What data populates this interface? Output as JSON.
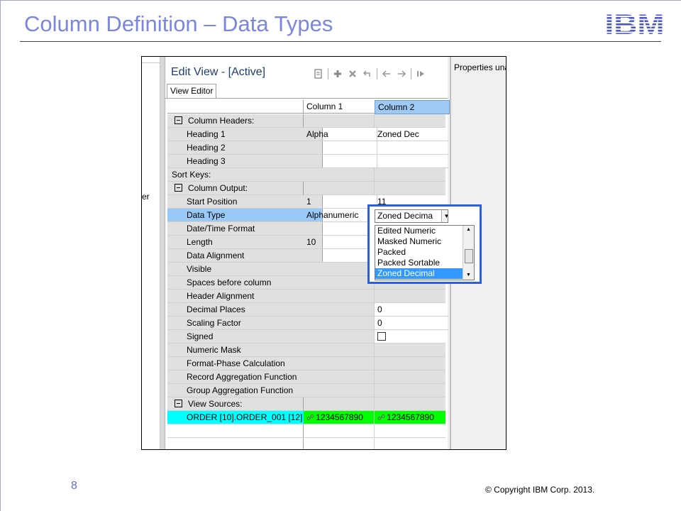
{
  "slide": {
    "title": "Column Definition – Data Types",
    "logo": "IBM",
    "page_number": "8",
    "copyright": "© Copyright  IBM Corp. 2013."
  },
  "screenshot": {
    "left_text": "er",
    "right_panel_text": "Properties una",
    "editor_title": "Edit View - [Active]",
    "tab_label": "View Editor",
    "toolbar_icons": [
      "export-icon",
      "add-icon",
      "delete-icon",
      "undo-icon",
      "move-left-icon",
      "move-right-icon",
      "step-icon"
    ],
    "columns": [
      "Column 1",
      "Column 2"
    ],
    "rows": [
      {
        "label": "Column Headers:",
        "type": "section",
        "col1": "",
        "col2": ""
      },
      {
        "label": "Heading 1",
        "col1": "Alpha",
        "col2": "Zoned Dec"
      },
      {
        "label": "Heading 2",
        "col1": "",
        "col2": ""
      },
      {
        "label": "Heading 3",
        "col1": "",
        "col2": ""
      },
      {
        "label": "Sort Keys:",
        "type": "plain",
        "col1": "",
        "col2": ""
      },
      {
        "label": "Column Output:",
        "type": "section",
        "col1": "",
        "col2": ""
      },
      {
        "label": "Start Position",
        "col1": "1",
        "col2": "11"
      },
      {
        "label": "Data Type",
        "col1": "Alphanumeric",
        "col2": ""
      },
      {
        "label": "Date/Time Format",
        "col1": "",
        "col2": ""
      },
      {
        "label": "Length",
        "col1": "10",
        "col2": ""
      },
      {
        "label": "Data Alignment",
        "col1": "",
        "col2": ""
      },
      {
        "label": "Visible",
        "col1": "",
        "col2": ""
      },
      {
        "label": "Spaces before column",
        "col1": "",
        "col2": ""
      },
      {
        "label": "Header Alignment",
        "col1": "",
        "col2": ""
      },
      {
        "label": "Decimal Places",
        "col1": "",
        "col2": "0"
      },
      {
        "label": "Scaling Factor",
        "col1": "",
        "col2": "0"
      },
      {
        "label": "Signed",
        "col1": "",
        "col2": ""
      },
      {
        "label": "Numeric Mask",
        "col1": "",
        "col2": ""
      },
      {
        "label": "Format-Phase Calculation",
        "col1": "",
        "col2": ""
      },
      {
        "label": "Record Aggregation Function",
        "col1": "",
        "col2": ""
      },
      {
        "label": "Group Aggregation Function",
        "col1": "",
        "col2": ""
      },
      {
        "label": "View Sources:",
        "type": "section",
        "col1": "",
        "col2": ""
      },
      {
        "label": "ORDER [10].ORDER_001 [12]",
        "col1": "1234567890",
        "col2": "1234567890"
      }
    ],
    "dropdown": {
      "selected": "Zoned Decima",
      "options": [
        "Edited Numeric",
        "Masked Numeric",
        "Packed",
        "Packed Sortable",
        "Zoned Decimal"
      ],
      "highlighted": "Zoned Decimal"
    }
  }
}
